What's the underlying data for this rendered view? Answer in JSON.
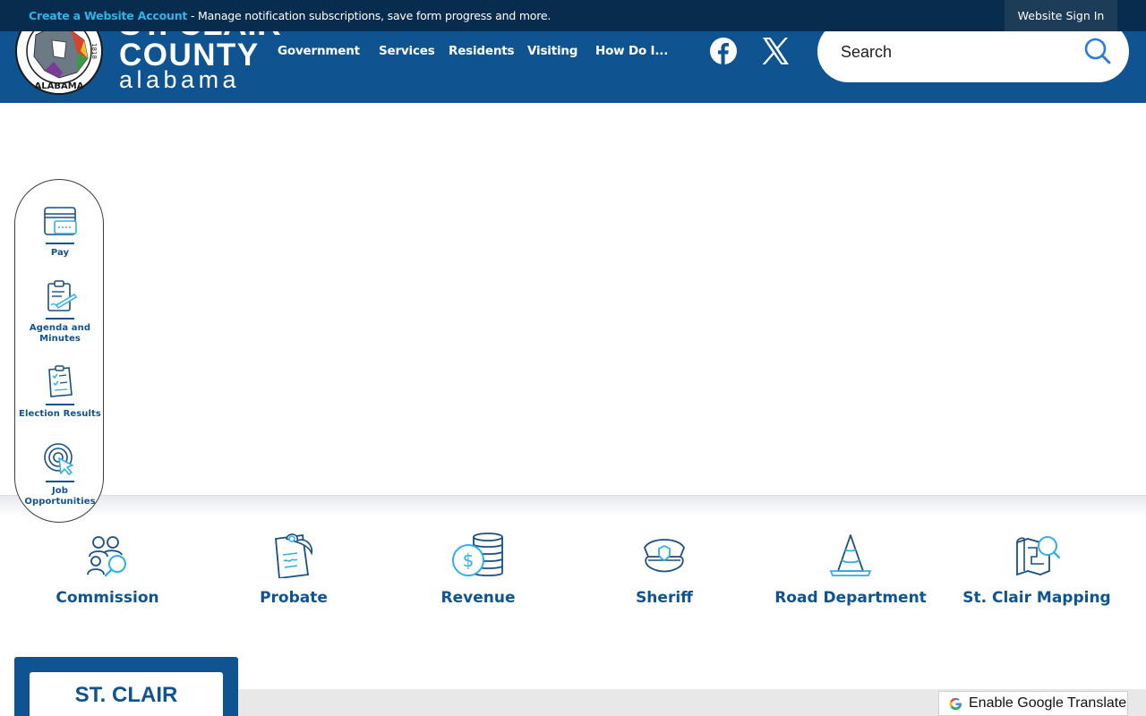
{
  "notification_bar": {
    "link_text": "Create a Website Account",
    "message": " - Manage notification subscriptions, save form progress and more.",
    "sign_in_label": "Website Sign In"
  },
  "logo": {
    "line1": "ST. CLAIR",
    "line2": "COUNTY",
    "line3": "alabama",
    "seal_text": "ALABAMA",
    "seal_year": "1818"
  },
  "nav": {
    "items": [
      "Government",
      "Services",
      "Residents",
      "Visiting",
      "How Do I..."
    ]
  },
  "social": {
    "facebook_icon": "facebook-icon",
    "x_icon": "x-twitter-icon"
  },
  "search": {
    "placeholder": "Search",
    "icon": "search-icon"
  },
  "quick_links": {
    "items": [
      {
        "label": "Pay",
        "icon": "credit-card-icon"
      },
      {
        "label": "Agenda and Minutes",
        "icon": "clipboard-pen-icon"
      },
      {
        "label": "Election Results",
        "icon": "checklist-icon"
      },
      {
        "label": "Job Opportunities",
        "icon": "target-cursor-icon"
      }
    ]
  },
  "departments": {
    "items": [
      {
        "label": "Commission",
        "icon": "people-search-icon"
      },
      {
        "label": "Probate",
        "icon": "document-seal-icon"
      },
      {
        "label": "Revenue",
        "icon": "coins-icon"
      },
      {
        "label": "Sheriff",
        "icon": "police-cap-icon"
      },
      {
        "label": "Road Department",
        "icon": "traffic-cone-icon"
      },
      {
        "label": "St. Clair Mapping",
        "icon": "map-search-icon"
      }
    ]
  },
  "footer_card": {
    "title": "ST. CLAIR"
  },
  "translate": {
    "label": "Enable Google Translate",
    "icon": "google-translate-icon"
  },
  "colors": {
    "header_blue": "#0f5391",
    "topbar_navy": "#072c4d",
    "accent_cyan": "#31b2e8"
  }
}
